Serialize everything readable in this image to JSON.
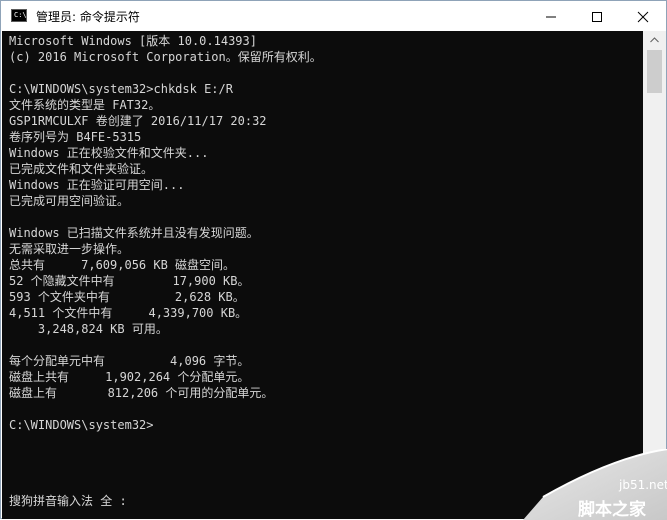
{
  "window": {
    "title": "管理员: 命令提示符",
    "icon_prompt": "C:\\"
  },
  "console": {
    "lines": [
      "Microsoft Windows [版本 10.0.14393]",
      "(c) 2016 Microsoft Corporation。保留所有权利。",
      "",
      "C:\\WINDOWS\\system32>chkdsk E:/R",
      "文件系统的类型是 FAT32。",
      "GSP1RMCULXF 卷创建了 2016/11/17 20:32",
      "卷序列号为 B4FE-5315",
      "Windows 正在校验文件和文件夹...",
      "已完成文件和文件夹验证。",
      "Windows 正在验证可用空间...",
      "已完成可用空间验证。",
      "",
      "Windows 已扫描文件系统并且没有发现问题。",
      "无需采取进一步操作。",
      "总共有     7,609,056 KB 磁盘空间。",
      "52 个隐藏文件中有        17,900 KB。",
      "593 个文件夹中有         2,628 KB。",
      "4,511 个文件中有     4,339,700 KB。",
      "    3,248,824 KB 可用。",
      "",
      "每个分配单元中有         4,096 字节。",
      "磁盘上共有     1,902,264 个分配单元。",
      "磁盘上有       812,206 个可用的分配单元。",
      "",
      "C:\\WINDOWS\\system32>"
    ],
    "ime_status": "搜狗拼音输入法 全 :"
  },
  "watermark": {
    "site": "jb51.net",
    "name": "脚本之家"
  },
  "colors": {
    "console_bg": "#0c0c0c",
    "console_text": "#d6d6d6",
    "watermark_bg": "#d9d9d9"
  }
}
